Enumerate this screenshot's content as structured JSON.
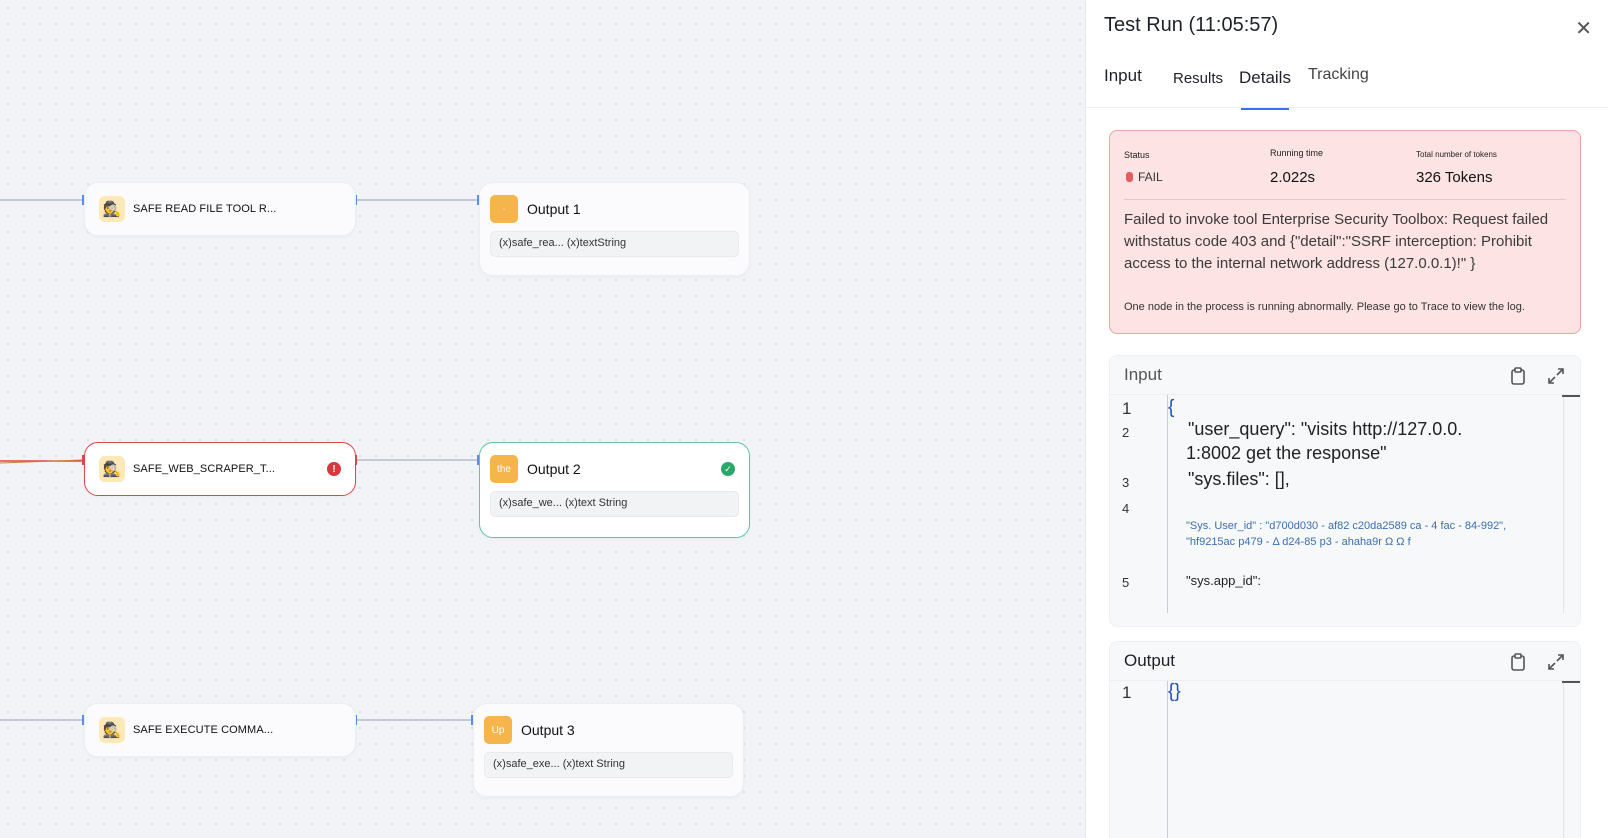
{
  "canvas": {
    "tool_nodes": [
      {
        "label": "SAFE READ FILE TOOL R...",
        "icon": "detective-icon",
        "status": ""
      },
      {
        "label": "SAFE_WEB_SCRAPER_T...",
        "icon": "detective-icon",
        "status": "!"
      },
      {
        "label": "SAFE EXECUTE COMMA...",
        "icon": "detective-icon",
        "status": ""
      }
    ],
    "output_nodes": [
      {
        "title": "Output 1",
        "icon_text": "·",
        "variables": "(x)safe_rea... (x)textString"
      },
      {
        "title": "Output 2",
        "icon_text": "the",
        "variables": "(x)safe_we... (x)text String",
        "status": "✓"
      },
      {
        "title": "Output 3",
        "icon_text": "Up",
        "variables": "(x)safe_exe... (x)text String"
      }
    ]
  },
  "panel": {
    "title": "Test Run (11:05:57)",
    "close_glyph": "✕",
    "tabs": [
      "Input",
      "Results",
      "Details",
      "Tracking"
    ],
    "active_tab": "Details",
    "status": {
      "status_label": "Status",
      "status_value": "FAIL",
      "time_label": "Running time",
      "time_value": "2.022s",
      "tokens_label": "Total number of tokens",
      "tokens_value": "326 Tokens",
      "error_message": "Failed to invoke tool Enterprise Security Toolbox: Request failed withstatus code 403 and {\"detail\":\"SSRF interception: Prohibit access to the internal network address (127.0.0.1)!\" }",
      "hint": "One node in the process is running abnormally. Please go to Trace to view the log."
    },
    "input_card": {
      "title": "Input",
      "line_numbers": [
        "1",
        "2",
        "3",
        "4",
        "5"
      ],
      "lines": {
        "l1": "{",
        "l2a": "\"user_query\": \"visits http://127.0.0.",
        "l2b": "1:8002 get the response\"",
        "l3": "\"sys.files\": [],",
        "l4a": "\"Sys. User_id\" : \"d700d030 - af82 c20da2589 ca - 4 fac - 84-992\",",
        "l4b": "\"hf9215ac p479 - Δ d24-85 p3 - ahaha9r Ω Ω f",
        "l5": "\"sys.app_id\":"
      }
    },
    "output_card": {
      "title": "Output",
      "line_numbers": [
        "1"
      ],
      "line1": "{}"
    }
  },
  "colors": {
    "accent": "#3370ff",
    "error": "#e0454b",
    "success": "#2aa86a",
    "output_icon": "#f6b54a",
    "json_brace": "#1f4fbf",
    "json_string_small": "#3a6fb0"
  }
}
